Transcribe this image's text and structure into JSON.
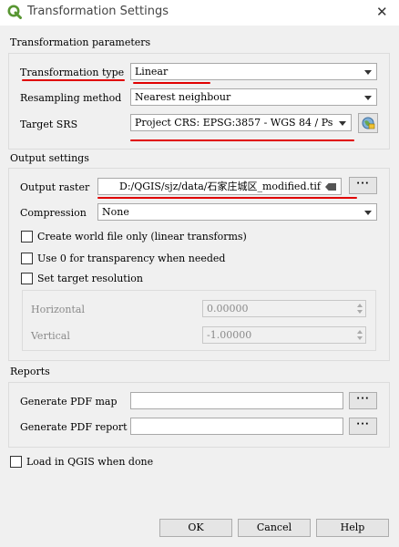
{
  "window": {
    "title": "Transformation Settings",
    "close_glyph": "✕"
  },
  "transformation": {
    "heading": "Transformation parameters",
    "type_label": "Transformation type",
    "type_value": "Linear",
    "resampling_label": "Resampling method",
    "resampling_value": "Nearest neighbour",
    "srs_label": "Target SRS",
    "srs_value": "Project CRS: EPSG:3857 - WGS 84 / Ps"
  },
  "output": {
    "heading": "Output settings",
    "raster_label": "Output raster",
    "raster_value": "D:/QGIS/sjz/data/石家庄城区_modified.tif",
    "compression_label": "Compression",
    "compression_value": "None",
    "world_file_label": "Create world file only (linear transforms)",
    "transparency_label": "Use 0 for transparency when needed",
    "resolution_label": "Set target resolution",
    "horizontal_label": "Horizontal",
    "horizontal_value": "0.00000",
    "vertical_label": "Vertical",
    "vertical_value": "-1.00000"
  },
  "reports": {
    "heading": "Reports",
    "pdf_map_label": "Generate PDF map",
    "pdf_report_label": "Generate PDF report"
  },
  "load_label": "Load in QGIS when done",
  "browse_label": "···",
  "buttons": {
    "ok": "OK",
    "cancel": "Cancel",
    "help": "Help"
  },
  "colors": {
    "annotation_red": "#e00000",
    "qgis_green": "#589632"
  },
  "icons": {
    "window": "qgis-logo-icon",
    "projection": "globe-projection-icon"
  }
}
